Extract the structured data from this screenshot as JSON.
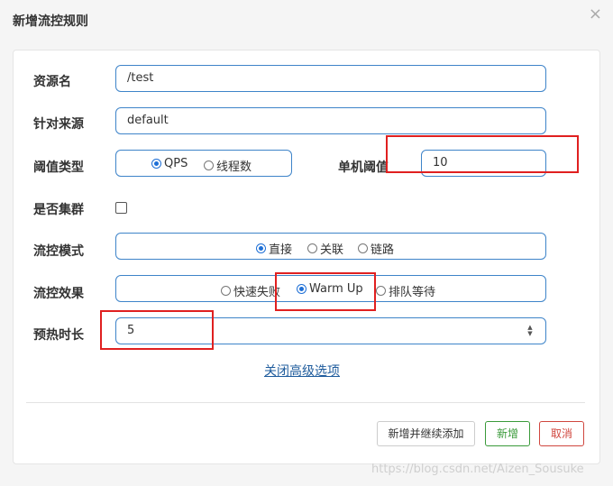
{
  "dialog": {
    "title": "新增流控规则",
    "close_symbol": "×"
  },
  "form": {
    "resource_name": {
      "label": "资源名",
      "value": "/test"
    },
    "limit_app": {
      "label": "针对来源",
      "value": "default"
    },
    "grade": {
      "label": "阈值类型",
      "options": [
        "QPS",
        "线程数"
      ],
      "selected": "QPS"
    },
    "threshold": {
      "label": "单机阈值",
      "value": "10"
    },
    "cluster": {
      "label": "是否集群",
      "checked": false
    },
    "strategy": {
      "label": "流控模式",
      "options": [
        "直接",
        "关联",
        "链路"
      ],
      "selected": "直接"
    },
    "control_behavior": {
      "label": "流控效果",
      "options": [
        "快速失败",
        "Warm Up",
        "排队等待"
      ],
      "selected": "Warm Up"
    },
    "warmup_period": {
      "label": "预热时长",
      "value": "5"
    },
    "advanced_link": "关闭高级选项"
  },
  "footer": {
    "add_continue_label": "新增并继续添加",
    "add_label": "新增",
    "cancel_label": "取消"
  },
  "watermark": "https://blog.csdn.net/Aizen_Sousuke",
  "colors": {
    "input_border": "#3e84c9",
    "radio_accent": "#1e6fd6",
    "add_button": "#3a9a3a",
    "cancel_button": "#d0463e",
    "highlight_box": "#e02020"
  }
}
